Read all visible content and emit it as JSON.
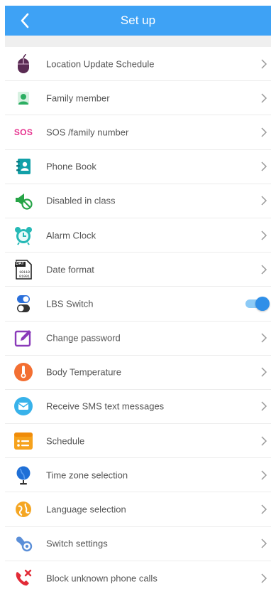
{
  "header": {
    "title": "Set up"
  },
  "items": [
    {
      "label": "Location Update Schedule",
      "icon": "mouse-icon"
    },
    {
      "label": "Family member",
      "icon": "person-icon"
    },
    {
      "label": "SOS /family number",
      "icon": "sos-icon",
      "icon_text": "SOS"
    },
    {
      "label": "Phone Book",
      "icon": "phone-book-icon"
    },
    {
      "label": "Disabled in class",
      "icon": "class-disabled-icon"
    },
    {
      "label": "Alarm Clock",
      "icon": "alarm-clock-icon"
    },
    {
      "label": "Date format",
      "icon": "date-format-icon",
      "icon_text": "DAT"
    },
    {
      "label": "LBS Switch",
      "icon": "switch-icon",
      "toggle": true
    },
    {
      "label": "Change password",
      "icon": "edit-icon"
    },
    {
      "label": "Body Temperature",
      "icon": "thermometer-icon"
    },
    {
      "label": "Receive SMS text messages",
      "icon": "sms-icon"
    },
    {
      "label": "Schedule",
      "icon": "schedule-icon"
    },
    {
      "label": "Time zone selection",
      "icon": "globe-icon"
    },
    {
      "label": "Language selection",
      "icon": "language-icon"
    },
    {
      "label": "Switch settings",
      "icon": "switch-settings-icon"
    },
    {
      "label": "Block unknown phone calls",
      "icon": "block-call-icon"
    }
  ],
  "colors": {
    "header": "#3ea2f5",
    "toggle": "#2f8fe8"
  }
}
